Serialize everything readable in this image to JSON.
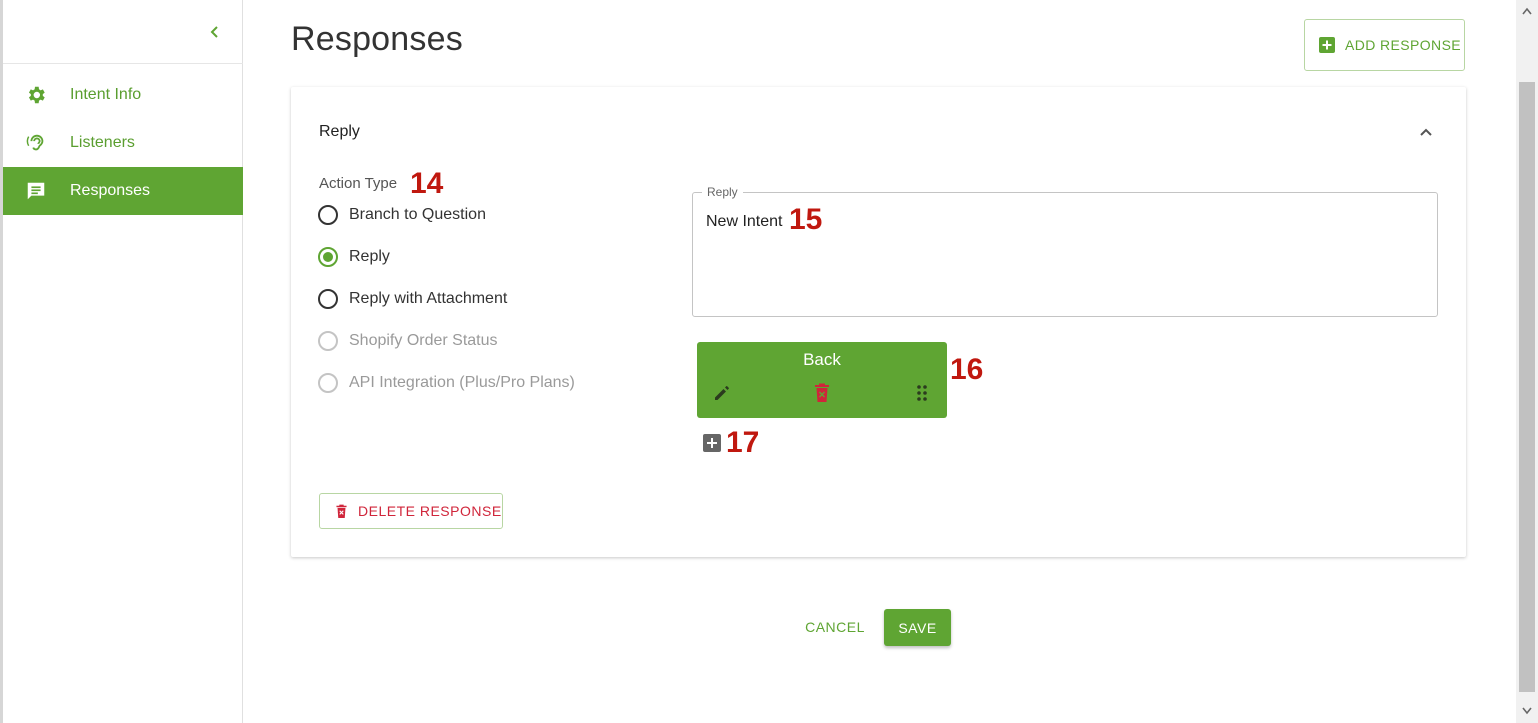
{
  "sidebar": {
    "items": [
      {
        "label": "Intent Info",
        "icon": "gear-icon",
        "active": false
      },
      {
        "label": "Listeners",
        "icon": "ear-icon",
        "active": false
      },
      {
        "label": "Responses",
        "icon": "chat-icon",
        "active": true
      }
    ]
  },
  "header": {
    "title": "Responses",
    "add_response_label": "ADD RESPONSE"
  },
  "response_card": {
    "title": "Reply",
    "action_type_label": "Action Type",
    "options": [
      {
        "label": "Branch to Question",
        "checked": false,
        "disabled": false
      },
      {
        "label": "Reply",
        "checked": true,
        "disabled": false
      },
      {
        "label": "Reply with Attachment",
        "checked": false,
        "disabled": false
      },
      {
        "label": "Shopify Order Status",
        "checked": false,
        "disabled": true
      },
      {
        "label": "API Integration (Plus/Pro Plans)",
        "checked": false,
        "disabled": true
      }
    ],
    "reply_field": {
      "legend": "Reply",
      "value": "New Intent"
    },
    "quick_reply": {
      "label": "Back"
    },
    "delete_label": "DELETE RESPONSE"
  },
  "markers": [
    "14",
    "15",
    "16",
    "17"
  ],
  "footer": {
    "cancel_label": "CANCEL",
    "save_label": "SAVE"
  },
  "colors": {
    "accent": "#5fa533",
    "danger": "#d0253a",
    "marker": "#c0180f"
  }
}
